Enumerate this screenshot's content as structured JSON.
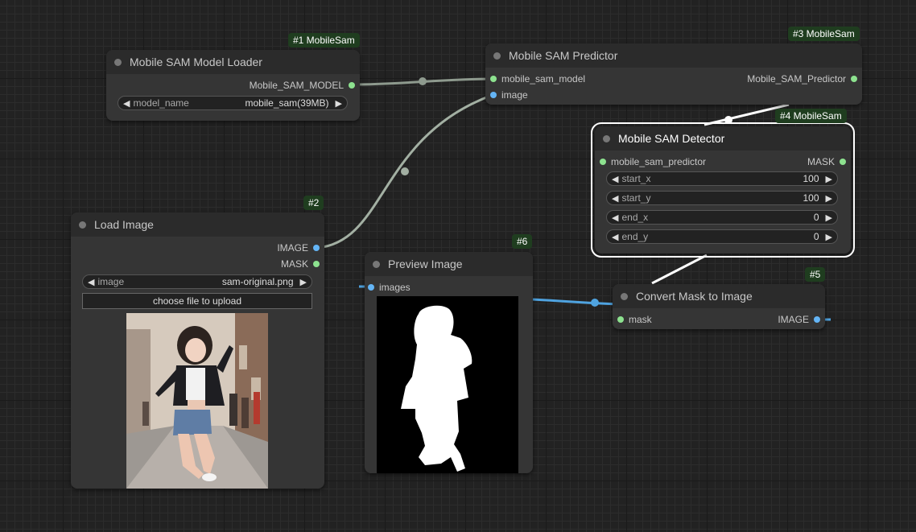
{
  "canvas": {
    "background": "#222222"
  },
  "colors": {
    "model_link": "#8e9a8e",
    "image_link": "#a3b0a3",
    "mask_link": "#4fa3e0",
    "selected_link": "#ffffff"
  },
  "nodes": {
    "model_loader": {
      "badge": "#1 MobileSam",
      "title": "Mobile SAM Model Loader",
      "output": "Mobile_SAM_MODEL",
      "widget": {
        "name": "model_name",
        "value": "mobile_sam(39MB)"
      }
    },
    "predictor": {
      "badge": "#3 MobileSam",
      "title": "Mobile SAM Predictor",
      "inputs": [
        "mobile_sam_model",
        "image"
      ],
      "output": "Mobile_SAM_Predictor"
    },
    "detector": {
      "badge": "#4 MobileSam",
      "title": "Mobile SAM Detector",
      "input": "mobile_sam_predictor",
      "output": "MASK",
      "widgets": [
        {
          "name": "start_x",
          "value": "100"
        },
        {
          "name": "start_y",
          "value": "100"
        },
        {
          "name": "end_x",
          "value": "0"
        },
        {
          "name": "end_y",
          "value": "0"
        }
      ]
    },
    "load_image": {
      "badge": "#2",
      "title": "Load Image",
      "outputs": [
        "IMAGE",
        "MASK"
      ],
      "widget": {
        "name": "image",
        "value": "sam-original.png"
      },
      "upload_label": "choose file to upload"
    },
    "preview_image": {
      "badge": "#6",
      "title": "Preview Image",
      "input": "images"
    },
    "convert_mask": {
      "badge": "#5",
      "title": "Convert Mask to Image",
      "input": "mask",
      "output": "IMAGE"
    }
  },
  "icons": {
    "left_arrow": "◀",
    "right_arrow": "▶"
  }
}
